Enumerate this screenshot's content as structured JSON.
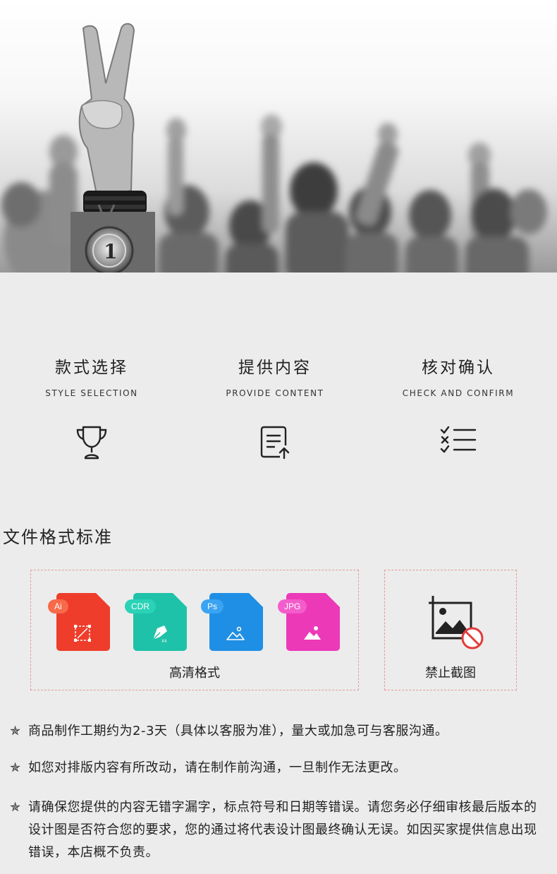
{
  "steps": [
    {
      "title_zh": "款式选择",
      "title_en": "STYLE SELECTION",
      "icon": "trophy-icon"
    },
    {
      "title_zh": "提供内容",
      "title_en": "PROVIDE CONTENT",
      "icon": "document-upload-icon"
    },
    {
      "title_zh": "核对确认",
      "title_en": "CHECK AND CONFIRM",
      "icon": "checklist-icon"
    }
  ],
  "file_section": {
    "title": "文件格式标准",
    "formats": [
      {
        "tag": "Ai",
        "color": "#ee3d2a",
        "icon": "ai-file-icon"
      },
      {
        "tag": "CDR",
        "color": "#1ec2a8",
        "icon": "cdr-file-icon"
      },
      {
        "tag": "Ps",
        "color": "#1f8fe5",
        "icon": "ps-file-icon"
      },
      {
        "tag": "JPG",
        "color": "#ec39b8",
        "icon": "jpg-file-icon"
      }
    ],
    "formats_label": "高清格式",
    "nocapture_label": "禁止截图",
    "nocapture_icon": "no-screenshot-icon"
  },
  "notes": [
    "商品制作工期约为2-3天（具体以客服为准），量大或加急可与客服沟通。",
    "如您对排版内容有所改动，请在制作前沟通，一旦制作无法更改。",
    "请确保您提供的内容无错字漏字，标点符号和日期等错误。请您务必仔细审核最后版本的设计图是否符合您的要求，您的通过将代表设计图最终确认无误。如因买家提供信息出现错误，本店概不负责。"
  ],
  "note_star": "✯"
}
